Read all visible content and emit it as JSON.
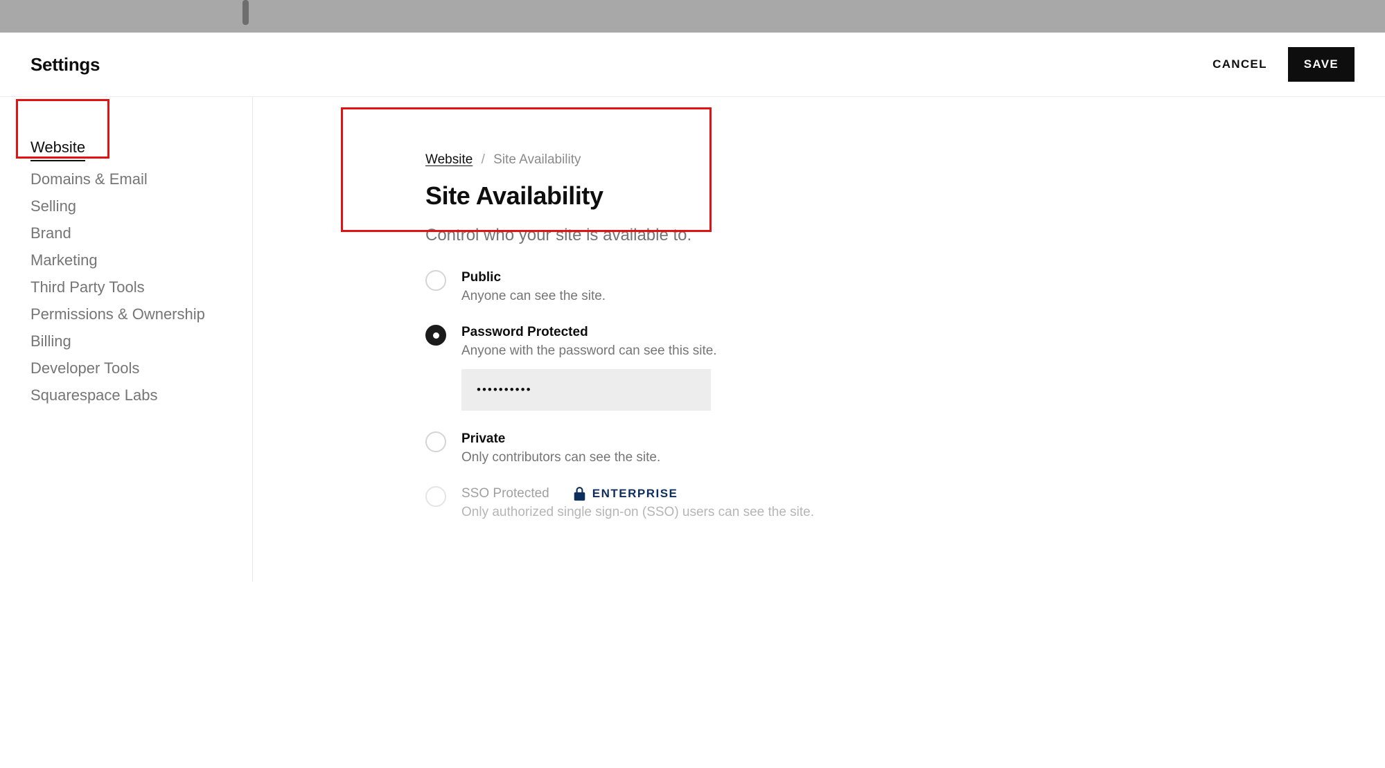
{
  "header": {
    "title": "Settings",
    "cancel_label": "CANCEL",
    "save_label": "SAVE"
  },
  "sidebar": {
    "items": [
      {
        "label": "Website",
        "active": true
      },
      {
        "label": "Domains & Email",
        "active": false
      },
      {
        "label": "Selling",
        "active": false
      },
      {
        "label": "Brand",
        "active": false
      },
      {
        "label": "Marketing",
        "active": false
      },
      {
        "label": "Third Party Tools",
        "active": false
      },
      {
        "label": "Permissions & Ownership",
        "active": false
      },
      {
        "label": "Billing",
        "active": false
      },
      {
        "label": "Developer Tools",
        "active": false
      },
      {
        "label": "Squarespace Labs",
        "active": false
      }
    ]
  },
  "breadcrumb": {
    "parent": "Website",
    "separator": "/",
    "current": "Site Availability"
  },
  "page": {
    "heading": "Site Availability",
    "subheading": "Control who your site is available to."
  },
  "options": {
    "public": {
      "title": "Public",
      "desc": "Anyone can see the site.",
      "selected": false
    },
    "password": {
      "title": "Password Protected",
      "desc": "Anyone with the password can see this site.",
      "selected": true,
      "value": "••••••••••"
    },
    "private": {
      "title": "Private",
      "desc": "Only contributors can see the site.",
      "selected": false
    },
    "sso": {
      "title": "SSO Protected",
      "desc": "Only authorized single sign-on (SSO) users can see the site.",
      "badge": "ENTERPRISE",
      "disabled": true
    }
  }
}
